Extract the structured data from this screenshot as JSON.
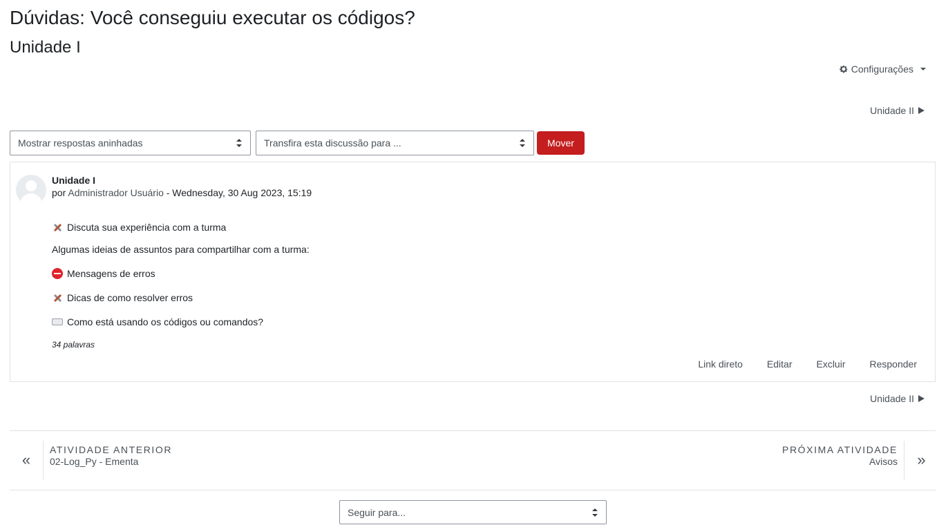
{
  "header": {
    "title": "Dúvidas: Você conseguiu executar os códigos?",
    "subtitle": "Unidade I",
    "settings_label": "Configurações"
  },
  "navigation": {
    "next_discussion_label": "Unidade II"
  },
  "controls": {
    "display_mode": "Mostrar respostas aninhadas",
    "move_target": "Transfira esta discussão para ...",
    "move_button": "Mover"
  },
  "post": {
    "subject": "Unidade I",
    "by_prefix": "por",
    "author": "Administrador Usuário",
    "date": " - Wednesday, 30 Aug 2023, 15:19",
    "lines": [
      {
        "icon": "tools-emoji",
        "text": "Discuta sua experiência com a turma"
      },
      {
        "icon": "",
        "text": "Algumas ideias de assuntos para compartilhar com a turma:"
      },
      {
        "icon": "no-entry-emoji",
        "text": "Mensagens de erros"
      },
      {
        "icon": "tools-emoji",
        "text": "Dicas de como resolver erros"
      },
      {
        "icon": "keyboard-emoji",
        "text": "Como está usando os códigos ou comandos?"
      }
    ],
    "word_count": "34 palavras",
    "actions": {
      "permalink": "Link direto",
      "edit": "Editar",
      "delete": "Excluir",
      "reply": "Responder"
    }
  },
  "activity_nav": {
    "prev_label": "ATIVIDADE ANTERIOR",
    "prev_name": "02-Log_Py - Ementa",
    "next_label": "PRÓXIMA ATIVIDADE",
    "next_name": "Avisos",
    "jump_placeholder": "Seguir para..."
  },
  "colors": {
    "accent": "#c41e1e",
    "link": "#495057",
    "border": "#dee2e6"
  }
}
